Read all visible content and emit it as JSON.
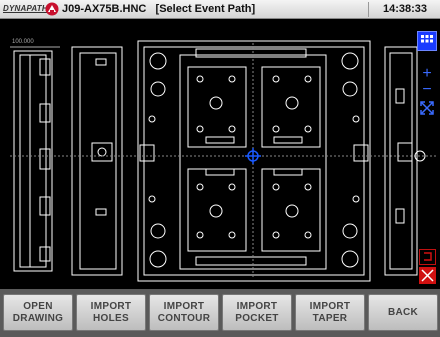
{
  "header": {
    "logo_text": "DYNAPATH",
    "title": "J09-AX75B.HNC   [Select Event Path]",
    "time": "14:38:33"
  },
  "drawing": {
    "scale_label": "100.000"
  },
  "side_tools": {
    "grid_icon": "grid-menu-icon",
    "zoom_in": "+",
    "zoom_out": "−",
    "fit": "fit-to-screen-icon",
    "undo": "undo-icon",
    "clear": "clear-x-icon"
  },
  "buttons": [
    {
      "line1": "OPEN",
      "line2": "DRAWING"
    },
    {
      "line1": "IMPORT",
      "line2": "HOLES"
    },
    {
      "line1": "IMPORT",
      "line2": "CONTOUR"
    },
    {
      "line1": "IMPORT",
      "line2": "POCKET"
    },
    {
      "line1": "IMPORT",
      "line2": "TAPER"
    },
    {
      "line1": "BACK",
      "line2": ""
    }
  ],
  "colors": {
    "accent_blue": "#1a3cff",
    "clear_red": "#d01010",
    "drawing_lines": "#ffffff"
  }
}
